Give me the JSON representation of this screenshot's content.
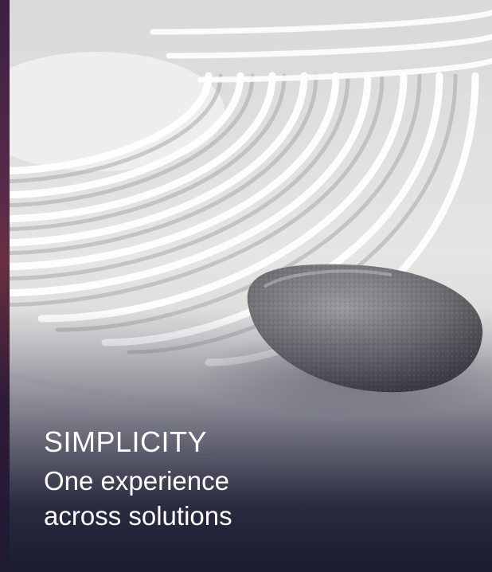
{
  "hero": {
    "heading": "SIMPLICITY",
    "subheading": "One experience across solutions",
    "image_subject": "zen sand garden with stone"
  },
  "colors": {
    "sidebar_strip": "#3a2240",
    "sand": "#e9e8e6",
    "overlay": "#1c1e34",
    "text": "#ffffff"
  }
}
